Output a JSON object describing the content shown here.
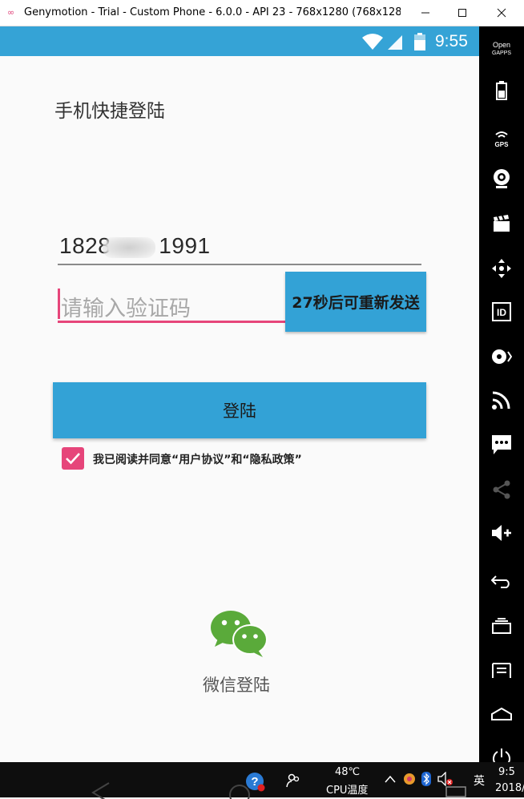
{
  "window": {
    "title": "Genymotion - Trial - Custom Phone - 6.0.0 - API 23 - 768x1280 (768x128...",
    "app_icon": "genymotion-logo",
    "minimize_icon": "minimize-icon",
    "maximize_icon": "maximize-icon",
    "close_icon": "close-icon"
  },
  "statusbar": {
    "time": "9:55",
    "color": "#35a3d6"
  },
  "screen": {
    "title": "手机快捷登陆",
    "phone_value": "1828",
    "phone_value_end": "1991",
    "code_placeholder": "请输入验证码",
    "resend_label": "27秒后可重新发送",
    "login_label": "登陆",
    "agree_checked": true,
    "agree_text": "我已阅读并同意“用户协议”和“隐私政策”",
    "wechat_label": "微信登陆",
    "accent": "#e6457a",
    "primary": "#33a2d6",
    "wechat_green": "#5aaa3a"
  },
  "toolbar": {
    "opengapps_line1": "Open",
    "opengapps_line2": "GAPPS",
    "gps_label": "GPS",
    "id_label": "ID",
    "items": [
      "opengapps-icon",
      "battery-icon",
      "gps-icon",
      "camera-icon",
      "clapperboard-icon",
      "move-icon",
      "id-icon",
      "media-icon",
      "cast-icon",
      "sms-icon",
      "share-icon",
      "volume-up-icon",
      "back-icon",
      "recent-apps-icon",
      "menu-icon",
      "home-icon",
      "power-icon"
    ]
  },
  "taskbar": {
    "temp": "48℃",
    "temp_label": "CPU温度",
    "ime": "英",
    "clock_time": "9:5",
    "clock_date": "2018/"
  }
}
